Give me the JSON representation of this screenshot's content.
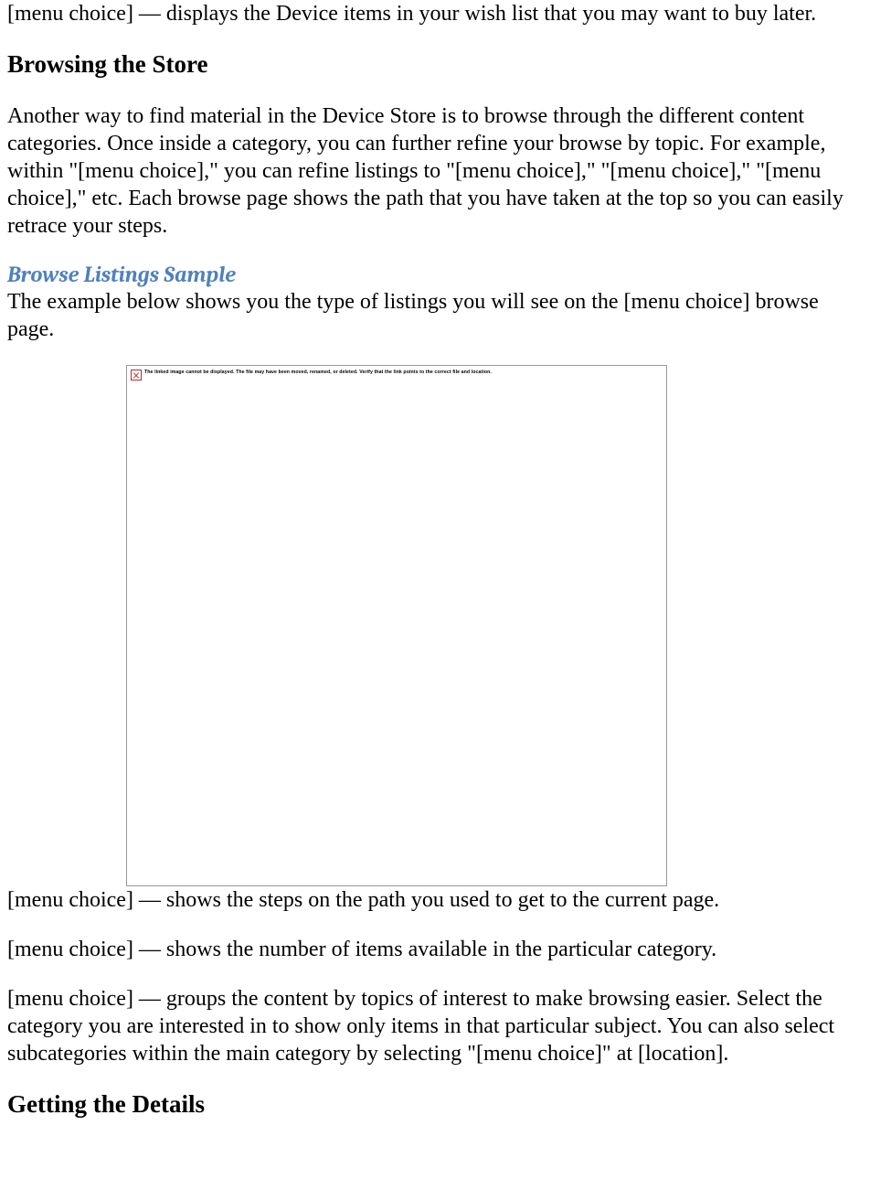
{
  "top_line": "[menu choice] — displays the Device items in your wish list that you may want to buy later.",
  "section_browsing": "Browsing the Store",
  "browsing_para": "Another way to find material in the Device Store is to browse through the different content categories. Once inside a category, you can further refine your browse by topic. For example, within \"[menu choice],\" you can refine listings to \"[menu choice],\" \"[menu choice],\" \"[menu choice],\" etc. Each browse page shows the path that you have taken at the top so you can easily retrace your steps.",
  "sample_heading": "Browse Listings Sample",
  "sample_intro": "The example below shows you the type of listings you will see on the [menu choice] browse page.",
  "placeholder_text": "The linked image cannot be displayed.  The file may have been moved, renamed, or deleted. Verify that the link points to the correct file and location.",
  "desc1": "[menu choice] — shows the steps on the path you used to get to the current page.",
  "desc2": "[menu choice] — shows the number of items available in the particular category.",
  "desc3": "[menu choice] — groups the content by topics of interest to make browsing easier. Select the category you are interested in to show only items in that particular subject. You can also select subcategories within the main category by selecting \"[menu choice]\" at [location].",
  "section_details": "Getting the Details"
}
